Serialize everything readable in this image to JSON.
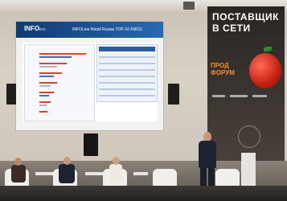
{
  "slide": {
    "logo": "INFO",
    "logo_suffix": "line",
    "title": "INFOLine Retail Russia TOP-10 FMCG"
  },
  "banner": {
    "line1": "ПОСТАВЩИК",
    "line2": "В СЕТИ",
    "forum_word1": "ПРОД",
    "forum_word2": "ФОРУМ"
  }
}
